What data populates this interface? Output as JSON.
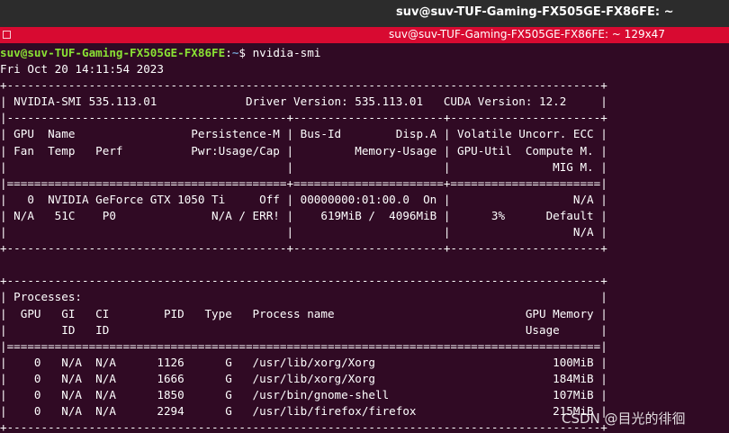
{
  "window": {
    "top_title": "suv@suv-TUF-Gaming-FX505GE-FX86FE: ~",
    "terminal_title": "suv@suv-TUF-Gaming-FX505GE-FX86FE: ~ 129x47"
  },
  "prompt": {
    "user_host": "suv@suv-TUF-Gaming-FX505GE-FX86FE",
    "colon": ":",
    "path": "~",
    "dollar": "$ ",
    "command": "nvidia-smi"
  },
  "output_lines": [
    "Fri Oct 20 14:11:54 2023",
    "+---------------------------------------------------------------------------------------+",
    "| NVIDIA-SMI 535.113.01             Driver Version: 535.113.01   CUDA Version: 12.2     |",
    "|-----------------------------------------+----------------------+----------------------+",
    "| GPU  Name                 Persistence-M | Bus-Id        Disp.A | Volatile Uncorr. ECC |",
    "| Fan  Temp   Perf          Pwr:Usage/Cap |         Memory-Usage | GPU-Util  Compute M. |",
    "|                                         |                      |               MIG M. |",
    "|=========================================+======================+======================|",
    "|   0  NVIDIA GeForce GTX 1050 Ti     Off | 00000000:01:00.0  On |                  N/A |",
    "| N/A   51C    P0              N/A / ERR! |    619MiB /  4096MiB |      3%      Default |",
    "|                                         |                      |                  N/A |",
    "+-----------------------------------------+----------------------+----------------------+",
    "",
    "+---------------------------------------------------------------------------------------+",
    "| Processes:                                                                            |",
    "|  GPU   GI   CI        PID   Type   Process name                            GPU Memory |",
    "|        ID   ID                                                             Usage      |",
    "|=======================================================================================|",
    "|    0   N/A  N/A      1126      G   /usr/lib/xorg/Xorg                          100MiB |",
    "|    0   N/A  N/A      1666      G   /usr/lib/xorg/Xorg                          184MiB |",
    "|    0   N/A  N/A      1850      G   /usr/bin/gnome-shell                        107MiB |",
    "|    0   N/A  N/A      2294      G   /usr/lib/firefox/firefox                    215MiB |",
    "+---------------------------------------------------------------------------------------+"
  ],
  "watermark": "CSDN @目光的徘徊",
  "colors": {
    "terminal_bg": "#300a24",
    "title_bar": "#d80a31",
    "top_bar": "#2c2c2c",
    "prompt_user": "#8ae234",
    "prompt_path": "#729fcf"
  }
}
